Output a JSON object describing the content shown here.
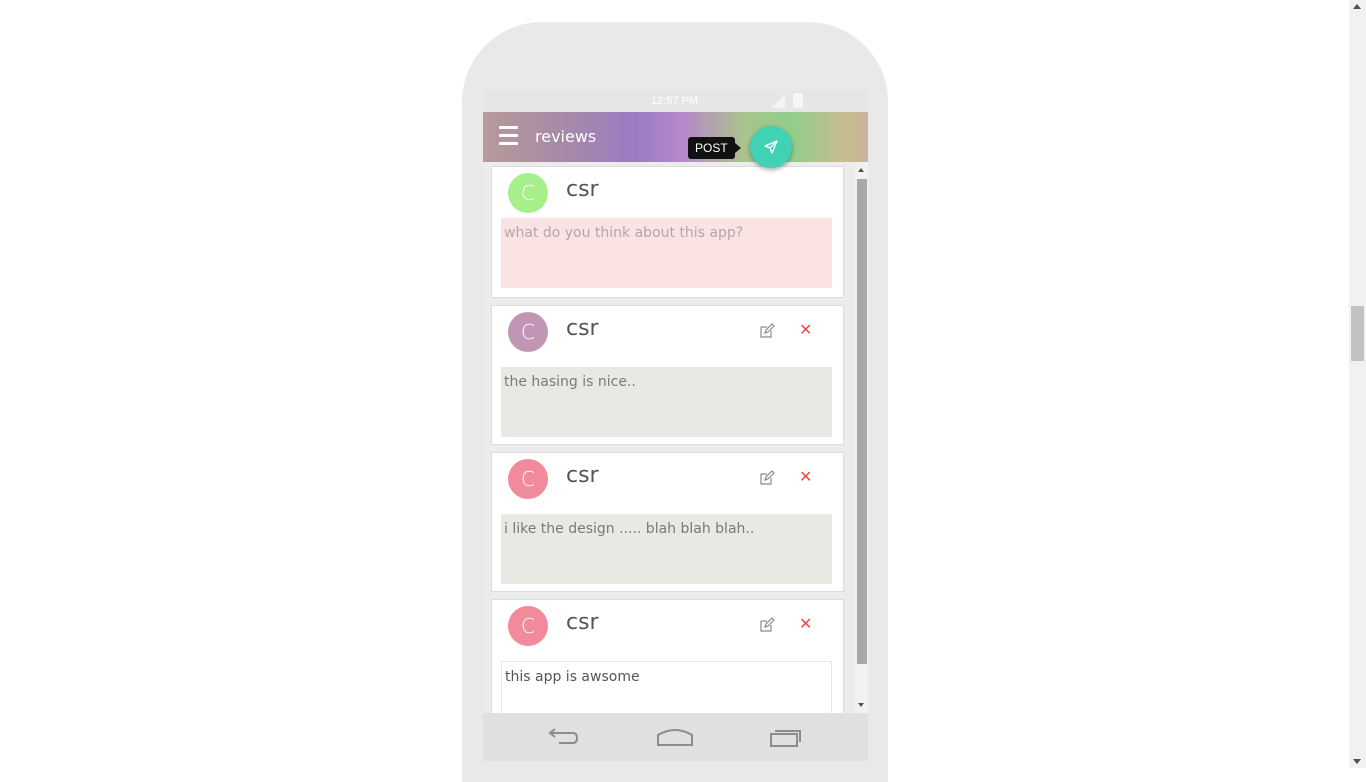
{
  "statusbar": {
    "time": "12:57 PM"
  },
  "appbar": {
    "title": "reviews"
  },
  "fab": {
    "tooltip": "POST",
    "icon": "send-icon",
    "color": "#41d2b6"
  },
  "reviews": [
    {
      "avatar_letter": "C",
      "avatar_color": "#a6ef8b",
      "username": "csr",
      "placeholder": "what do you think about this app?",
      "editable": false,
      "bg": "#fbe3e3"
    },
    {
      "avatar_letter": "C",
      "avatar_color": "#c096b4",
      "username": "csr",
      "text": "the hasing is nice..",
      "editable": true,
      "bg": "#e9e8e3"
    },
    {
      "avatar_letter": "C",
      "avatar_color": "#f18a9a",
      "username": "csr",
      "text": "i like the design ..... blah blah blah..",
      "editable": true,
      "bg": "#e9e8e3"
    },
    {
      "avatar_letter": "C",
      "avatar_color": "#f18a9a",
      "username": "csr",
      "text": "this app is awsome",
      "editable": true,
      "bg": "#ffffff"
    }
  ],
  "icons": {
    "edit": "edit-icon",
    "delete": "close-icon",
    "menu": "menu-icon",
    "back": "back-icon",
    "home": "home-icon",
    "recents": "recents-icon"
  },
  "colors": {
    "delete": "#e84c4c"
  }
}
